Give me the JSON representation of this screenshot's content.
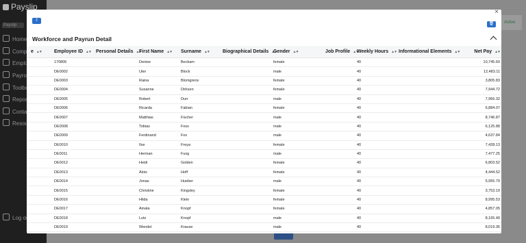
{
  "app": {
    "logo": "Payslip",
    "pill": "Payslip",
    "nav": [
      "Home",
      "Companies",
      "Employees",
      "Payroll",
      "Toolbox",
      "Reports",
      "Contact",
      "Resources"
    ],
    "logout": "Log out",
    "right_panel_text": "Active"
  },
  "modal": {
    "title": "Workforce and Payrun Detail",
    "close_glyph": "×",
    "left_button_icon": "upload-icon",
    "right_button_icon": "trash-icon",
    "columns": [
      {
        "key": "partial",
        "label": "e"
      },
      {
        "key": "employee_id",
        "label": "Employee ID"
      },
      {
        "key": "personal_details",
        "label": "Personal Details"
      },
      {
        "key": "first_name",
        "label": "First Name"
      },
      {
        "key": "surname",
        "label": "Surname"
      },
      {
        "key": "biographical_details",
        "label": "Biographical Details"
      },
      {
        "key": "gender",
        "label": "Gender"
      },
      {
        "key": "job_profile",
        "label": "Job Profile"
      },
      {
        "key": "weekly_hours",
        "label": "Weekly Hours"
      },
      {
        "key": "informational_elements",
        "label": "Informational Elements"
      },
      {
        "key": "net_pay",
        "label": "Net Pay"
      }
    ],
    "rows": [
      {
        "employee_id": "170806",
        "first_name": "Denise",
        "surname": "Beckam",
        "gender": "female",
        "weekly_hours": "40",
        "net_pay": "10,745.60"
      },
      {
        "employee_id": "DE0002",
        "first_name": "Uter",
        "surname": "Block",
        "gender": "male",
        "weekly_hours": "40",
        "net_pay": "12,483.11"
      },
      {
        "employee_id": "DE0003",
        "first_name": "Raina",
        "surname": "Blomgrens",
        "gender": "female",
        "weekly_hours": "40",
        "net_pay": "3,805.83"
      },
      {
        "employee_id": "DE0004",
        "first_name": "Susanne",
        "surname": "Dirksen",
        "gender": "female",
        "weekly_hours": "40",
        "net_pay": "7,944.72"
      },
      {
        "employee_id": "DE0005",
        "first_name": "Robert",
        "surname": "Durr",
        "gender": "male",
        "weekly_hours": "40",
        "net_pay": "7,966.32"
      },
      {
        "employee_id": "DE0006",
        "first_name": "Ricarda",
        "surname": "Fabian",
        "gender": "female",
        "weekly_hours": "40",
        "net_pay": "6,884.07"
      },
      {
        "employee_id": "DE0007",
        "first_name": "Matthias",
        "surname": "Fischer",
        "gender": "male",
        "weekly_hours": "40",
        "net_pay": "8,746.87"
      },
      {
        "employee_id": "DE0008",
        "first_name": "Tobias",
        "surname": "Foss",
        "gender": "male",
        "weekly_hours": "40",
        "net_pay": "6,125.88"
      },
      {
        "employee_id": "DE0009",
        "first_name": "Ferdinand",
        "surname": "Fox",
        "gender": "male",
        "weekly_hours": "40",
        "net_pay": "4,637.84"
      },
      {
        "employee_id": "DE0010",
        "first_name": "Ilse",
        "surname": "Freya",
        "gender": "female",
        "weekly_hours": "40",
        "net_pay": "7,428.13"
      },
      {
        "employee_id": "DE0011",
        "first_name": "Herman",
        "surname": "Fuxg",
        "gender": "male",
        "weekly_hours": "40",
        "net_pay": "7,477.25"
      },
      {
        "employee_id": "DE0012",
        "first_name": "Heidi",
        "surname": "Golden",
        "gender": "female",
        "weekly_hours": "40",
        "net_pay": "6,803.52"
      },
      {
        "employee_id": "DE0013",
        "first_name": "Alois",
        "surname": "Hoff",
        "gender": "female",
        "weekly_hours": "40",
        "net_pay": "4,444.52"
      },
      {
        "employee_id": "DE0014",
        "first_name": "Jonas",
        "surname": "Hueber",
        "gender": "male",
        "weekly_hours": "40",
        "net_pay": "5,955.79"
      },
      {
        "employee_id": "DE0015",
        "first_name": "Christine",
        "surname": "Kingsley",
        "gender": "female",
        "weekly_hours": "40",
        "net_pay": "3,753.19"
      },
      {
        "employee_id": "DE0016",
        "first_name": "Hilda",
        "surname": "Klein",
        "gender": "female",
        "weekly_hours": "40",
        "net_pay": "8,995.53"
      },
      {
        "employee_id": "DE0017",
        "first_name": "Amala",
        "surname": "Knopf",
        "gender": "female",
        "weekly_hours": "40",
        "net_pay": "4,857.05"
      },
      {
        "employee_id": "DE0018",
        "first_name": "Lutz",
        "surname": "Knopf",
        "gender": "male",
        "weekly_hours": "40",
        "net_pay": "8,165.49"
      },
      {
        "employee_id": "DE0019",
        "first_name": "Wendel",
        "surname": "Krause",
        "gender": "male",
        "weekly_hours": "40",
        "net_pay": "8,019.36"
      }
    ]
  }
}
